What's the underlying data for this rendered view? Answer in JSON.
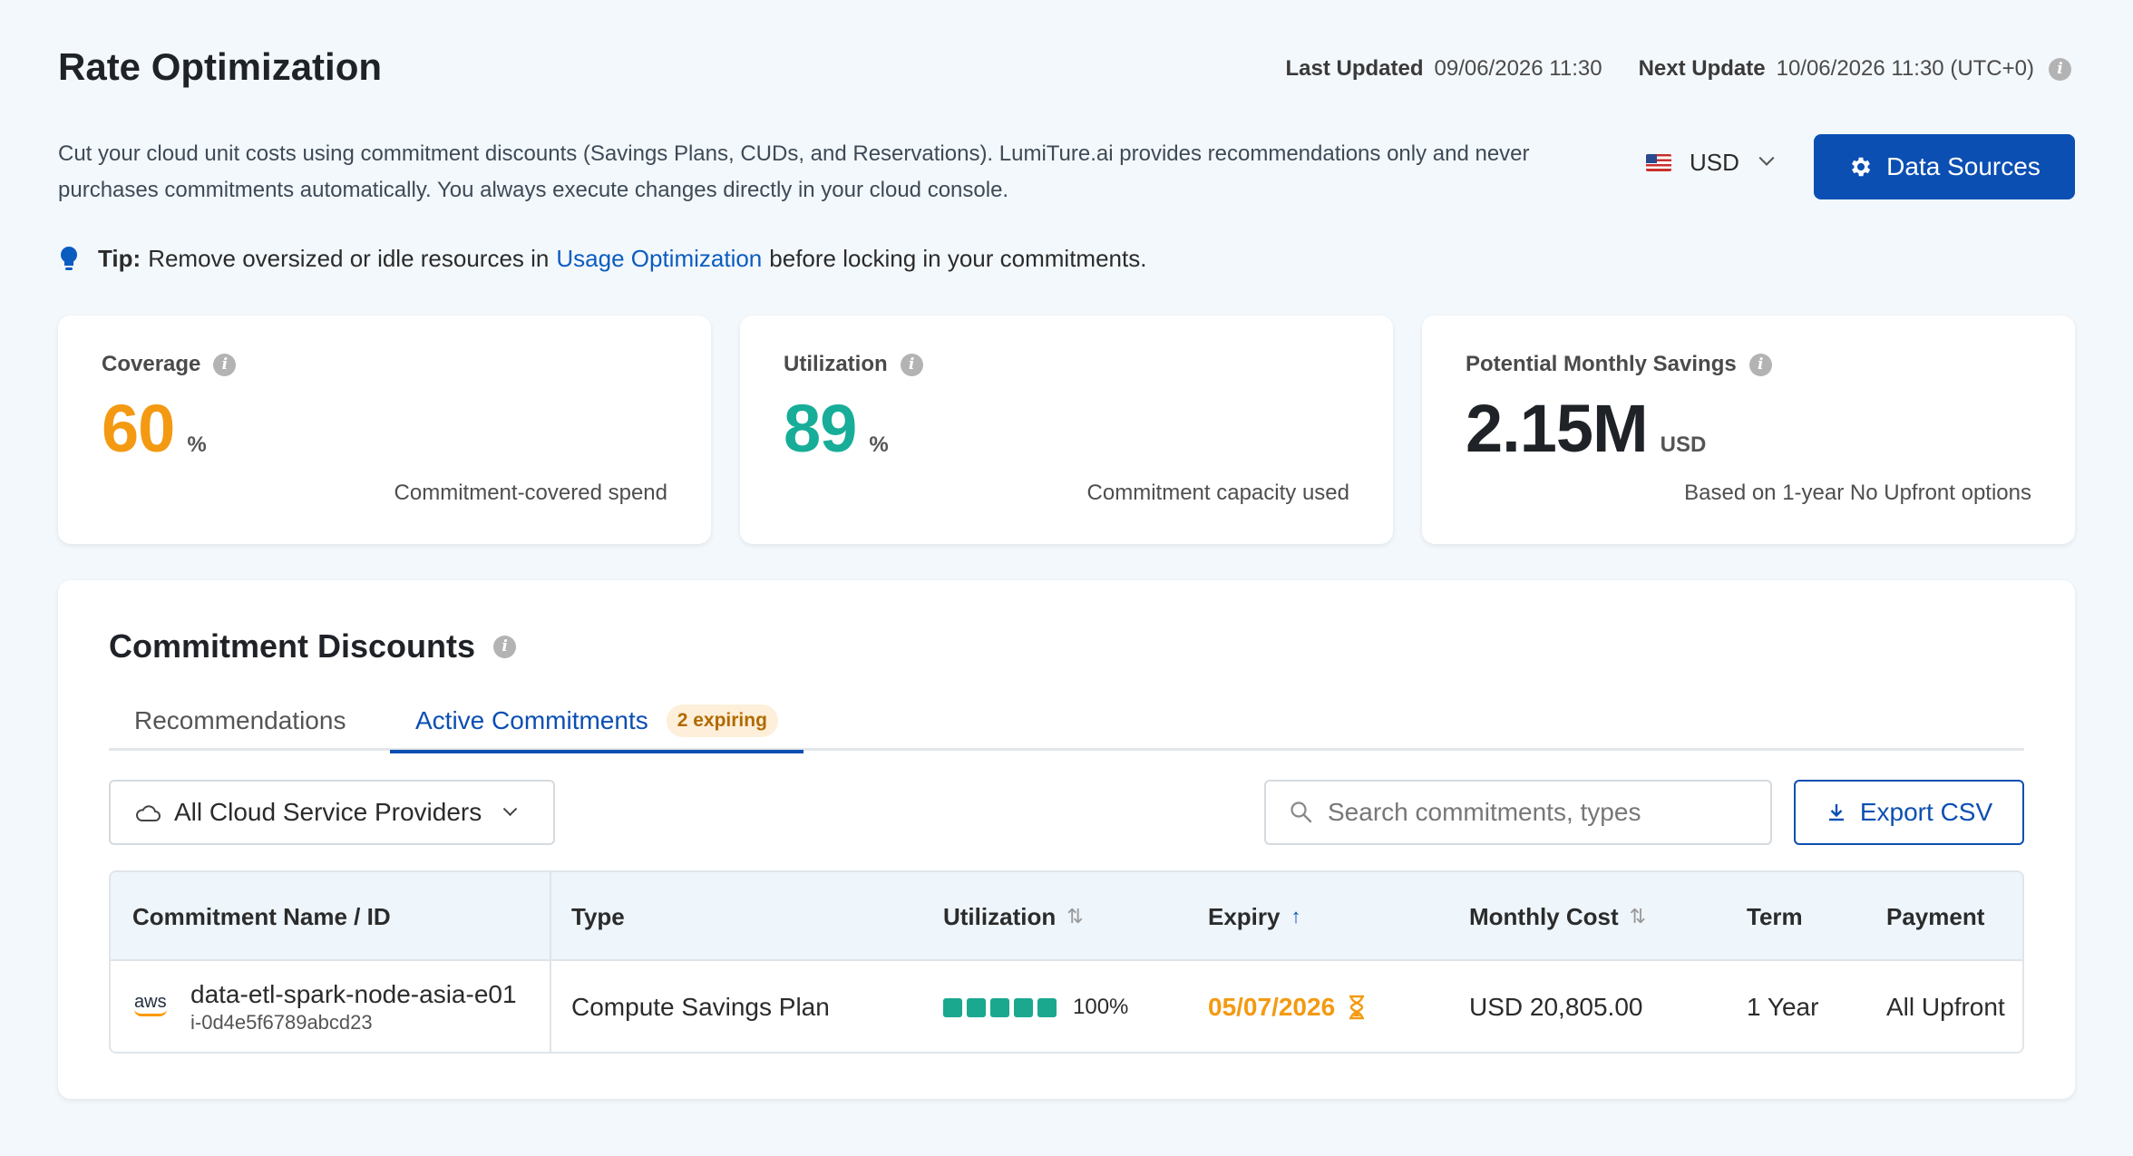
{
  "header": {
    "title": "Rate Optimization",
    "last_updated_label": "Last Updated",
    "last_updated_value": "09/06/2026 11:30",
    "next_update_label": "Next Update",
    "next_update_value": "10/06/2026 11:30 (UTC+0)",
    "description": "Cut your cloud unit costs using commitment discounts (Savings Plans, CUDs, and Reservations). LumiTure.ai provides recommendations only and never purchases commitments automatically. You always execute changes directly in your cloud console.",
    "currency": "USD",
    "data_sources_label": "Data Sources"
  },
  "tip": {
    "label": "Tip:",
    "text_before": "Remove oversized or idle resources in",
    "link": "Usage Optimization",
    "text_after": "before locking in your commitments."
  },
  "kpis": [
    {
      "title": "Coverage",
      "value": "60",
      "unit": "%",
      "caption": "Commitment-covered spend",
      "color": "#f39a12"
    },
    {
      "title": "Utilization",
      "value": "89",
      "unit": "%",
      "caption": "Commitment capacity used",
      "color": "#17ad98"
    },
    {
      "title": "Potential Monthly Savings",
      "value": "2.15M",
      "unit": "USD",
      "caption": "Based on 1-year No Upfront options",
      "color": "#1f2328"
    }
  ],
  "commitments": {
    "title": "Commitment Discounts",
    "tabs": [
      {
        "label": "Recommendations"
      },
      {
        "label": "Active Commitments",
        "badge": "2 expiring"
      }
    ],
    "filter_value": "All Cloud Service Providers",
    "search_placeholder": "Search commitments, types",
    "export_label": "Export CSV",
    "columns": [
      "Commitment Name / ID",
      "Type",
      "Utilization",
      "Expiry",
      "Monthly Cost",
      "Term",
      "Payment"
    ],
    "rows": [
      {
        "provider": "aws",
        "name": "data-etl-spark-node-asia-e01",
        "id": "i-0d4e5f6789abcd23",
        "type": "Compute Savings Plan",
        "utilization": "100%",
        "utilization_fraction": 1.0,
        "expiry": "05/07/2026",
        "monthly_cost": "USD 20,805.00",
        "term": "1 Year",
        "payment": "All Upfront"
      }
    ]
  }
}
